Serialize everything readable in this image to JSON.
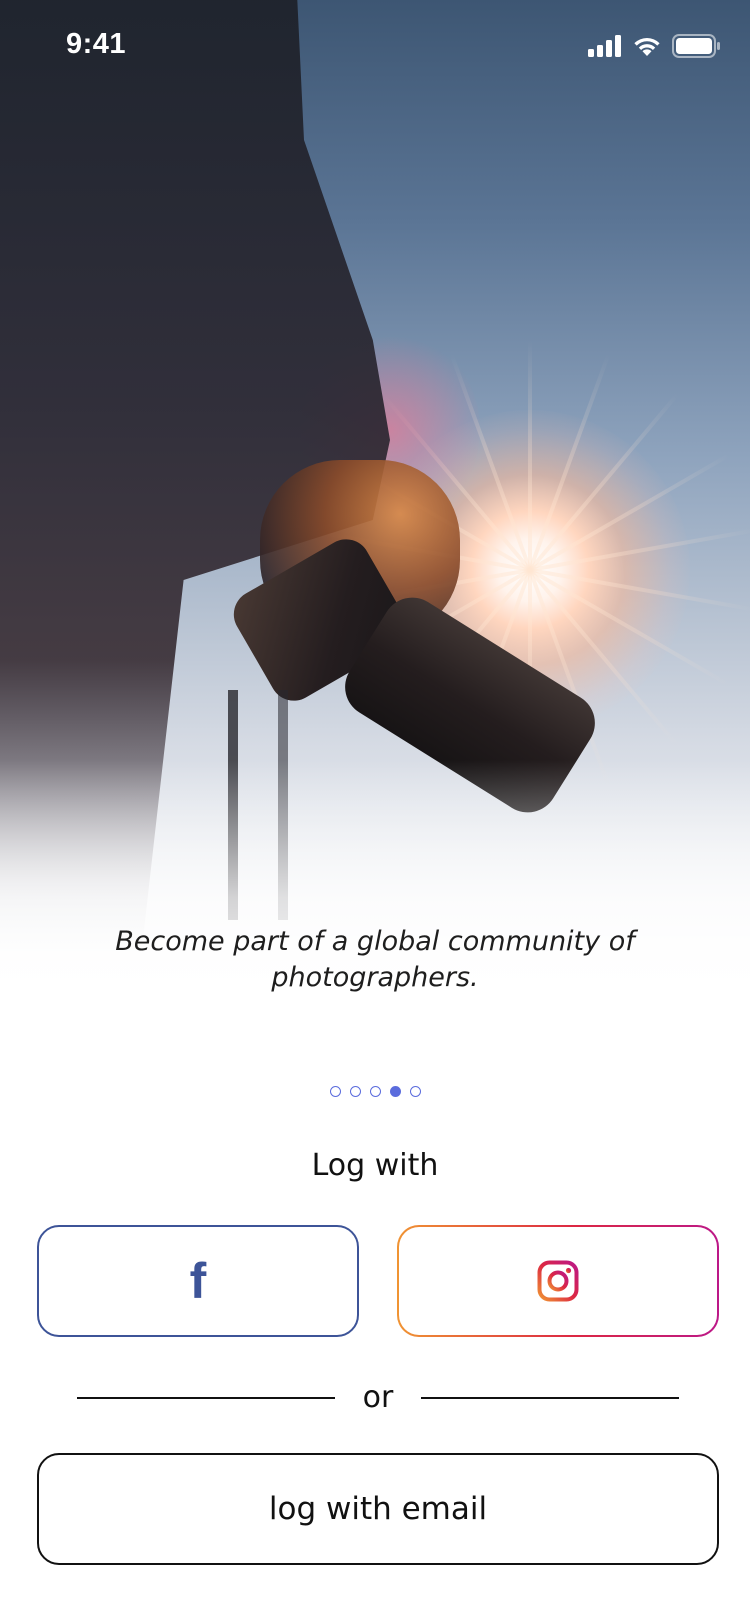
{
  "status_bar": {
    "time": "9:41",
    "icons": [
      "cellular-signal-icon",
      "wifi-icon",
      "battery-icon"
    ]
  },
  "hero": {
    "caption": "Become part of a global community of photographers."
  },
  "pager": {
    "total": 5,
    "active_index": 3,
    "color": "#5b6cdd"
  },
  "login": {
    "title": "Log with",
    "facebook": {
      "icon": "facebook-icon",
      "glyph": "f",
      "color": "#3d5498"
    },
    "instagram": {
      "icon": "instagram-icon",
      "colors": [
        "#f09433",
        "#dc2743",
        "#bc1888"
      ]
    },
    "divider_text": "or",
    "email_button": "log with email"
  }
}
